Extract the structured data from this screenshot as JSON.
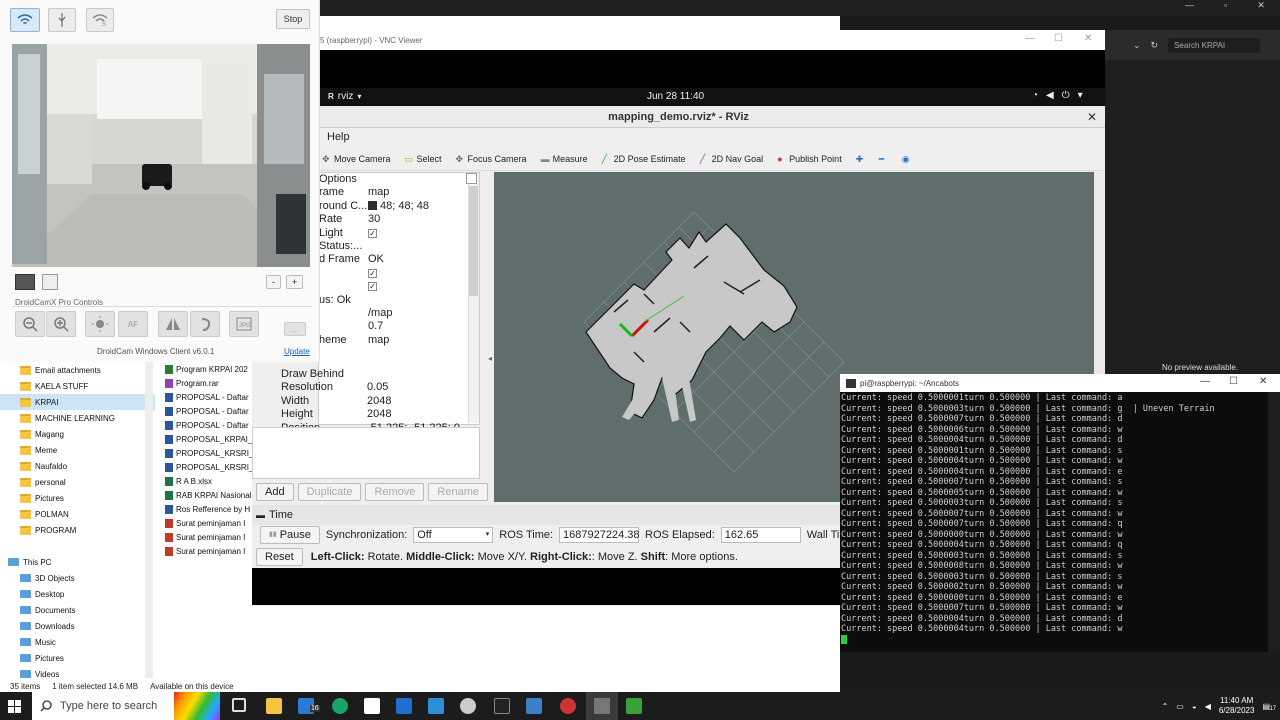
{
  "droidcam": {
    "stop_label": "Stop",
    "zoom_minus": "-",
    "zoom_plus": "+",
    "pro_controls_label": "DroidCamX Pro Controls",
    "af_label": "AF",
    "more_label": "...",
    "footer_text": "DroidCam Windows Client v6.0.1",
    "update_link": "Update"
  },
  "vnc": {
    "title": "5 (raspberrypi) - VNC Viewer"
  },
  "gnome": {
    "app_menu": "rviz",
    "clock": "Jun 28  11:40"
  },
  "rviz": {
    "title": "mapping_demo.rviz* - RViz",
    "menu_help": "Help",
    "tools": [
      {
        "label": "Move Camera",
        "icon": "move-camera-icon"
      },
      {
        "label": "Select",
        "icon": "select-icon"
      },
      {
        "label": "Focus Camera",
        "icon": "focus-camera-icon"
      },
      {
        "label": "Measure",
        "icon": "measure-icon"
      },
      {
        "label": "2D Pose Estimate",
        "icon": "pose-estimate-icon"
      },
      {
        "label": "2D Nav Goal",
        "icon": "nav-goal-icon"
      },
      {
        "label": "Publish Point",
        "icon": "publish-point-icon"
      }
    ],
    "displays": [
      {
        "key": "Options",
        "value": ""
      },
      {
        "key": "rame",
        "value": "map"
      },
      {
        "key": "round C...",
        "value": "48; 48; 48",
        "swatch": "#303030"
      },
      {
        "key": "Rate",
        "value": "30"
      },
      {
        "key": " Light",
        "value": "",
        "check": "✓"
      },
      {
        "key": "Status:...",
        "value": ""
      },
      {
        "key": "d Frame",
        "value": "OK"
      },
      {
        "key": "",
        "value": "",
        "check": "✓"
      },
      {
        "key": "",
        "value": "",
        "check": "✓"
      },
      {
        "key": "us: Ok",
        "value": ""
      },
      {
        "key": "",
        "value": "/map"
      },
      {
        "key": "",
        "value": "0.7"
      },
      {
        "key": "heme",
        "value": "map"
      }
    ],
    "props": [
      {
        "key": "Draw Behind",
        "value": ""
      },
      {
        "key": "Resolution",
        "value": "0.05"
      },
      {
        "key": "Width",
        "value": "2048"
      },
      {
        "key": "Height",
        "value": "2048"
      },
      {
        "key": "Position",
        "value": "-51.225; -51.225; 0"
      }
    ],
    "buttons": {
      "add": "Add",
      "duplicate": "Duplicate",
      "remove": "Remove",
      "rename": "Rename"
    },
    "time": {
      "panel_title": "Time",
      "pause_label": "Pause",
      "sync_label": "Synchronization:",
      "sync_value": "Off",
      "ros_time_label": "ROS Time:",
      "ros_time_value": "1687927224.38",
      "ros_elapsed_label": "ROS Elapsed:",
      "ros_elapsed_value": "162.65",
      "wall_label": "Wall Tin"
    },
    "help": {
      "reset_label": "Reset",
      "left_click": "Left-Click:",
      "left_text": "Rotate.",
      "middle_click": "Middle-Click:",
      "middle_text": "Move X/Y.",
      "right_click": "Right-Click:",
      "right_text": ": Move Z.",
      "shift": "Shift",
      "shift_text": ": More options."
    }
  },
  "terminal": {
    "title": "pi@raspberrypi: ~/Ancabots",
    "lines": [
      "Current: speed 0.5000001turn 0.500000 | Last command: a",
      "Current: speed 0.5000003turn 0.500000 | Last command: g  | Uneven Terrain",
      "Current: speed 0.5000007turn 0.500000 | Last command: d",
      "Current: speed 0.5000006turn 0.500000 | Last command: w",
      "Current: speed 0.5000004turn 0.500000 | Last command: d",
      "Current: speed 0.5000001turn 0.500000 | Last command: s",
      "Current: speed 0.5000004turn 0.500000 | Last command: w",
      "Current: speed 0.5000004turn 0.500000 | Last command: e",
      "Current: speed 0.5000007turn 0.500000 | Last command: s",
      "Current: speed 0.5000005turn 0.500000 | Last command: w",
      "Current: speed 0.5000003turn 0.500000 | Last command: s",
      "Current: speed 0.5000007turn 0.500000 | Last command: w",
      "Current: speed 0.5000007turn 0.500000 | Last command: q",
      "Current: speed 0.5000000turn 0.500000 | Last command: w",
      "Current: speed 0.5000004turn 0.500000 | Last command: q",
      "Current: speed 0.5000003turn 0.500000 | Last command: s",
      "Current: speed 0.5000008turn 0.500000 | Last command: w",
      "Current: speed 0.5000003turn 0.500000 | Last command: s",
      "Current: speed 0.5000002turn 0.500000 | Last command: w",
      "Current: speed 0.5000000turn 0.500000 | Last command: e",
      "Current: speed 0.5000007turn 0.500000 | Last command: w",
      "Current: speed 0.5000004turn 0.500000 | Last command: d",
      "Current: speed 0.5000004turn 0.500000 | Last command: w"
    ]
  },
  "browser": {
    "search_placeholder": "Search KRPAI",
    "no_preview": "No preview available."
  },
  "explorer": {
    "nav": [
      {
        "label": "Email attachments",
        "type": "folder"
      },
      {
        "label": "KAELA STUFF",
        "type": "folder"
      },
      {
        "label": "KRPAI",
        "type": "folder",
        "selected": true
      },
      {
        "label": "MACHINE LEARNING",
        "type": "folder"
      },
      {
        "label": "Magang",
        "type": "folder"
      },
      {
        "label": "Meme",
        "type": "folder"
      },
      {
        "label": "Naufaldo",
        "type": "folder"
      },
      {
        "label": "personal",
        "type": "folder"
      },
      {
        "label": "Pictures",
        "type": "folder"
      },
      {
        "label": "POLMAN",
        "type": "folder"
      },
      {
        "label": "PROGRAM",
        "type": "folder"
      },
      {
        "label": "",
        "type": "blank"
      },
      {
        "label": "This PC",
        "type": "pc"
      },
      {
        "label": "3D Objects",
        "type": "pc"
      },
      {
        "label": "Desktop",
        "type": "pc"
      },
      {
        "label": "Documents",
        "type": "pc"
      },
      {
        "label": "Downloads",
        "type": "pc"
      },
      {
        "label": "Music",
        "type": "pc"
      },
      {
        "label": "Pictures",
        "type": "pc"
      },
      {
        "label": "Videos",
        "type": "pc"
      }
    ],
    "files": [
      {
        "label": "Program KRPAI 202",
        "color": "#2e7d32"
      },
      {
        "label": "Program.rar",
        "color": "#8e44ad"
      },
      {
        "label": "PROPOSAL - Daftar",
        "color": "#2b579a"
      },
      {
        "label": "PROPOSAL - Daftar",
        "color": "#2b579a"
      },
      {
        "label": "PROPOSAL - Daftar",
        "color": "#2b579a"
      },
      {
        "label": "PROPOSAL_KRPAI_2",
        "color": "#2b579a"
      },
      {
        "label": "PROPOSAL_KRSRI_2",
        "color": "#2b579a"
      },
      {
        "label": "PROPOSAL_KRSRI_2",
        "color": "#2b579a"
      },
      {
        "label": "R A B.xlsx",
        "color": "#217346"
      },
      {
        "label": "RAB KRPAI Nasional",
        "color": "#217346"
      },
      {
        "label": "Ros Refference by H",
        "color": "#2b579a"
      },
      {
        "label": "Surat peminjaman I",
        "color": "#c0392b"
      },
      {
        "label": "Surat peminjaman I",
        "color": "#c0392b"
      },
      {
        "label": "Surat peminjaman I",
        "color": "#c0392b"
      }
    ],
    "status": {
      "items": "35 items",
      "selected": "1 item selected  14.6 MB",
      "available": "Available on this device"
    }
  },
  "taskbar": {
    "search_placeholder": "Type here to search",
    "time": "11:40 AM",
    "date": "6/28/2023",
    "notif_count": "17",
    "mail_badge": "16"
  }
}
